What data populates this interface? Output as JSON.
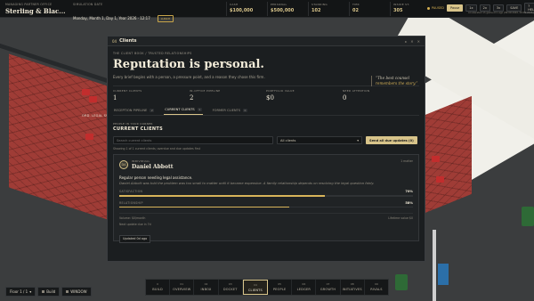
{
  "topbar": {
    "firm_label": "MANAGING PARTNER OFFICE",
    "firm_name": "Sterling & Blac...",
    "date_label": "SIMULATION DATE",
    "date_text": "Monday, Month 1, Day 1, Year 2026 · 12:17",
    "launch_label": "LUNCH",
    "stats": [
      {
        "label": "CASH",
        "value": "$100,000"
      },
      {
        "label": "PERSONAL",
        "value": "$500,000"
      },
      {
        "label": "STANDING",
        "value": "102"
      },
      {
        "label": "TIER",
        "value": "02"
      },
      {
        "label": "INSIDE ST.",
        "value": "305"
      }
    ],
    "paused_label": "PAUSED",
    "speed_buttons": [
      "Pause",
      "1x",
      "2x",
      "3x"
    ],
    "save_label": "SAVE",
    "help_label": "? HELP",
    "accel_note": "Accelerated 1h game-min ago (09:09:2026, 09:09:2026)"
  },
  "floor": {
    "label": "Floor 1 / 1",
    "build_label": "Build",
    "mode_label": "WINDOW"
  },
  "world": {
    "room_label": "ORD. LEGAL SVCS"
  },
  "nav": [
    {
      "num": "0",
      "label": "BUILD"
    },
    {
      "num": "01",
      "label": "OVERVIEW"
    },
    {
      "num": "02",
      "label": "INBOX"
    },
    {
      "num": "03",
      "label": "DOCKET"
    },
    {
      "num": "04",
      "label": "CLIENTS"
    },
    {
      "num": "05",
      "label": "PEOPLE"
    },
    {
      "num": "06",
      "label": "LEDGER"
    },
    {
      "num": "07",
      "label": "GROWTH"
    },
    {
      "num": "08",
      "label": "INITIATIVES"
    },
    {
      "num": "09",
      "label": "RIVALS"
    }
  ],
  "panel": {
    "icon_text": "04",
    "title": "Clients",
    "header_icons": [
      "▸",
      "✕",
      "✕"
    ],
    "kicker": "THE CLIENT BOOK / TRUSTED RELATIONSHIPS",
    "hero_title": "Reputation is personal.",
    "hero_sub": "Every brief begins with a person, a pressure point, and a reason they chose this firm.",
    "quote_text": "“The best counsel",
    "quote_em": "remembers the story.”",
    "metrics": [
      {
        "label": "CURRENT CLIENTS",
        "value": "1"
      },
      {
        "label": "IN-OFFICE PIPELINE",
        "value": "2"
      },
      {
        "label": "PORTFOLIO VALUE",
        "value": "$0"
      },
      {
        "label": "NEED ATTENTION",
        "value": "0"
      }
    ],
    "tabs": [
      {
        "label": "RECEPTION PIPELINE",
        "count": "2"
      },
      {
        "label": "CURRENT CLIENTS",
        "count": "1"
      },
      {
        "label": "FORMER CLIENTS",
        "count": "0"
      }
    ],
    "section_kicker": "PEOPLE IN YOUR CORNER",
    "section_title": "CURRENT CLIENTS",
    "count_note": "1 clients with the firm",
    "search_placeholder": "Search current clients",
    "select_value": "All clients",
    "send_label": "Send all due updates (0)",
    "showing_note": "Showing 1 of 1 current clients; overdue and due updates first",
    "card": {
      "initials": "DA",
      "type": "INDIVIDUAL",
      "name": "Daniel Abbott",
      "matters": "1 matter",
      "need": "Regular person needing legal assistance.",
      "story": "Daniel Abbott was told the problem was too small to matter until it became expensive. A family relationship depends on resolving the legal question fairly.",
      "satisfaction_label": "SATISFACTION",
      "satisfaction_value": "70%",
      "satisfaction_fill": 0.7,
      "relationship_label": "RELATIONSHIP",
      "relationship_value": "58%",
      "relationship_fill": 0.58,
      "volume_note": "Volume: $0/month",
      "lifetime_note": "Lifetime value $0",
      "next_update": "Next update due in 7d",
      "updated_label": "Updated 0d ago"
    }
  }
}
